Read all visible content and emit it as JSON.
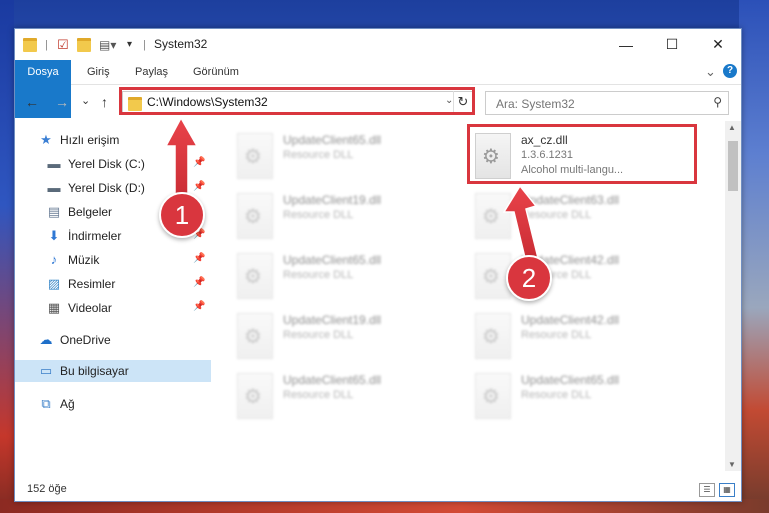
{
  "window": {
    "title": "System32",
    "controls": {
      "minimize": "—",
      "maximize": "☐",
      "close": "✕"
    }
  },
  "ribbon": {
    "tabs": [
      "Dosya",
      "Giriş",
      "Paylaş",
      "Görünüm"
    ],
    "help": "?",
    "collapse": "⌄"
  },
  "nav": {
    "back": "←",
    "forward": "→",
    "recent": "⌄",
    "up": "↑",
    "address": "C:\\Windows\\System32",
    "search_placeholder": "Ara: System32"
  },
  "sidebar": {
    "items": [
      {
        "label": "Hızlı erişim",
        "icon": "star-icon",
        "glyph": "★"
      },
      {
        "label": "Yerel Disk (C:)",
        "icon": "drive-icon",
        "glyph": "▬"
      },
      {
        "label": "Yerel Disk (D:)",
        "icon": "drive-icon",
        "glyph": "▬"
      },
      {
        "label": "Belgeler",
        "icon": "documents-icon",
        "glyph": "▤"
      },
      {
        "label": "İndirmeler",
        "icon": "download-icon",
        "glyph": "⬇"
      },
      {
        "label": "Müzik",
        "icon": "music-icon",
        "glyph": "♪"
      },
      {
        "label": "Resimler",
        "icon": "pictures-icon",
        "glyph": "▨"
      },
      {
        "label": "Videolar",
        "icon": "videos-icon",
        "glyph": "▦"
      },
      {
        "label": "OneDrive",
        "icon": "cloud-icon",
        "glyph": "☁"
      },
      {
        "label": "Bu bilgisayar",
        "icon": "computer-icon",
        "glyph": "▭"
      },
      {
        "label": "Ağ",
        "icon": "network-icon",
        "glyph": "⧉"
      }
    ]
  },
  "files": {
    "col1": [
      {
        "name": "UpdateClient65.dll",
        "type": "Resource DLL"
      },
      {
        "name": "UpdateClient19.dll",
        "type": "Resource DLL"
      },
      {
        "name": "UpdateClient65.dll",
        "type": "Resource DLL"
      },
      {
        "name": "UpdateClient19.dll",
        "type": "Resource DLL"
      },
      {
        "name": "UpdateClient65.dll",
        "type": "Resource DLL"
      }
    ],
    "highlighted": {
      "name": "ax_cz.dll",
      "version": "1.3.6.1231",
      "description": "Alcohol multi-langu..."
    },
    "col2": [
      {
        "name": "UpdateClient63.dll",
        "type": "Resource DLL"
      },
      {
        "name": "UpdateClient42.dll",
        "type": "Resource DLL"
      },
      {
        "name": "UpdateClient42.dll",
        "type": "Resource DLL"
      },
      {
        "name": "UpdateClient65.dll",
        "type": "Resource DLL"
      }
    ]
  },
  "status": {
    "count": "152 öğe"
  },
  "annotations": {
    "step1": "1",
    "step2": "2"
  },
  "colors": {
    "accent": "#1979ca",
    "highlight": "#d9363e",
    "selected": "#cce4f7"
  }
}
